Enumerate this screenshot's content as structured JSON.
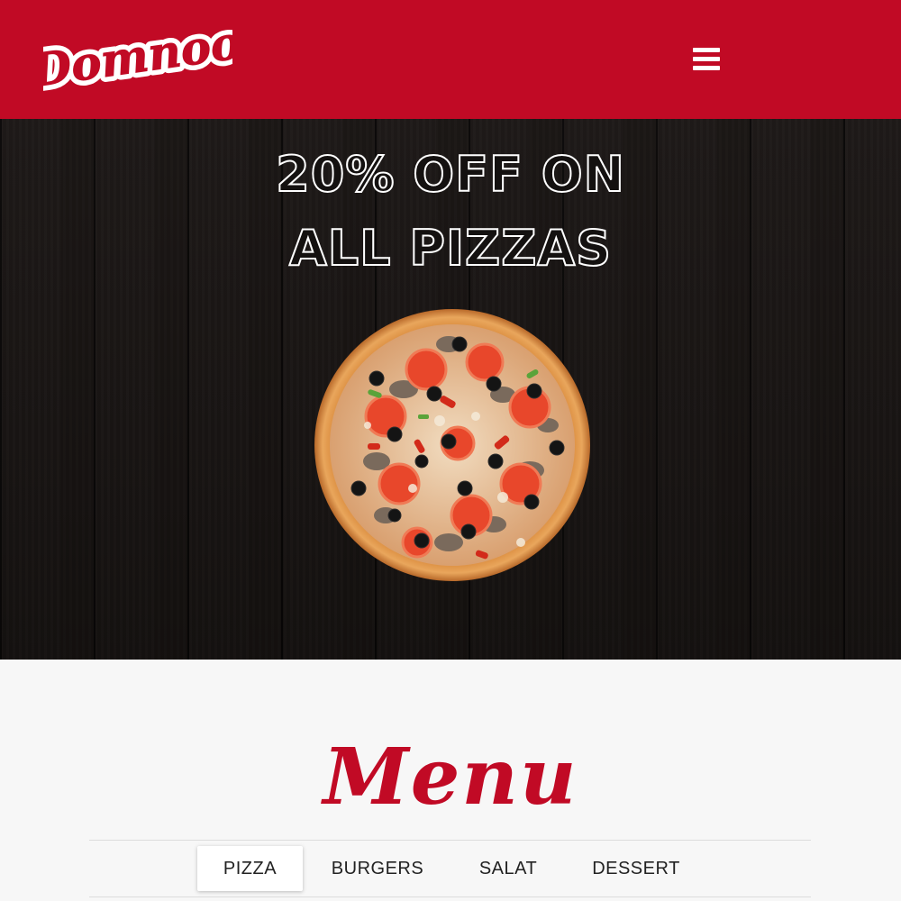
{
  "brand": {
    "logo_text": "Domnoo",
    "color": "#c10a25"
  },
  "header": {
    "menu_icon": "hamburger-menu-icon"
  },
  "hero": {
    "headline_line1": "20% OFF ON",
    "headline_line2": "ALL PIZZAS",
    "image": "pizza"
  },
  "menu": {
    "title": "Menu",
    "tabs": [
      {
        "label": "PIZZA",
        "active": true
      },
      {
        "label": "BURGERS",
        "active": false
      },
      {
        "label": "SALAT",
        "active": false
      },
      {
        "label": "DESSERT",
        "active": false
      }
    ]
  }
}
